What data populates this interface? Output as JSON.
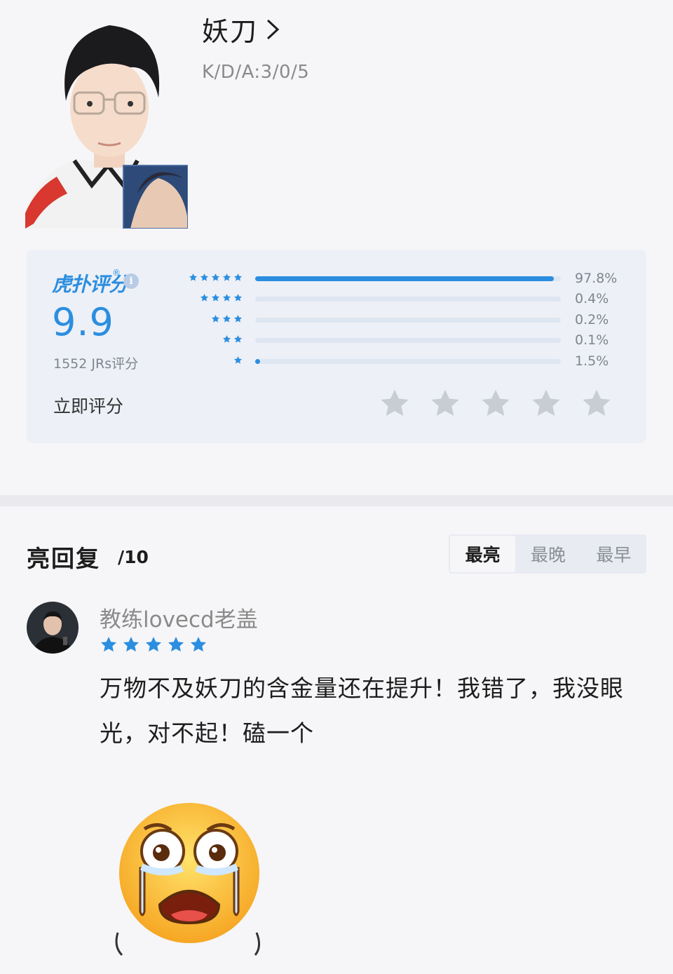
{
  "player": {
    "name": "妖刀",
    "kda": "K/D/A:3/0/5"
  },
  "rating": {
    "brand": "虎扑评分",
    "score": "9.9",
    "count": "1552 JRs评分",
    "rate_now_label": "立即评分",
    "distribution": [
      {
        "stars": 5,
        "percent": 97.8,
        "label": "97.8%"
      },
      {
        "stars": 4,
        "percent": 0.4,
        "label": "0.4%"
      },
      {
        "stars": 3,
        "percent": 0.2,
        "label": "0.2%"
      },
      {
        "stars": 2,
        "percent": 0.1,
        "label": "0.1%"
      },
      {
        "stars": 1,
        "percent": 1.5,
        "label": "1.5%"
      }
    ]
  },
  "replies": {
    "title": "亮回复",
    "count": "/10",
    "sort_tabs": [
      "最亮",
      "最晚",
      "最早"
    ],
    "active_tab": 0
  },
  "comment": {
    "username": "教练lovecd老盖",
    "stars": 5,
    "text": "万物不及妖刀的含金量还在提升！我错了，我没眼光，对不起！磕一个"
  },
  "colors": {
    "accent": "#2b8ee0",
    "card_bg": "#edf0f6",
    "inactive_star": "#c8ccd3"
  }
}
